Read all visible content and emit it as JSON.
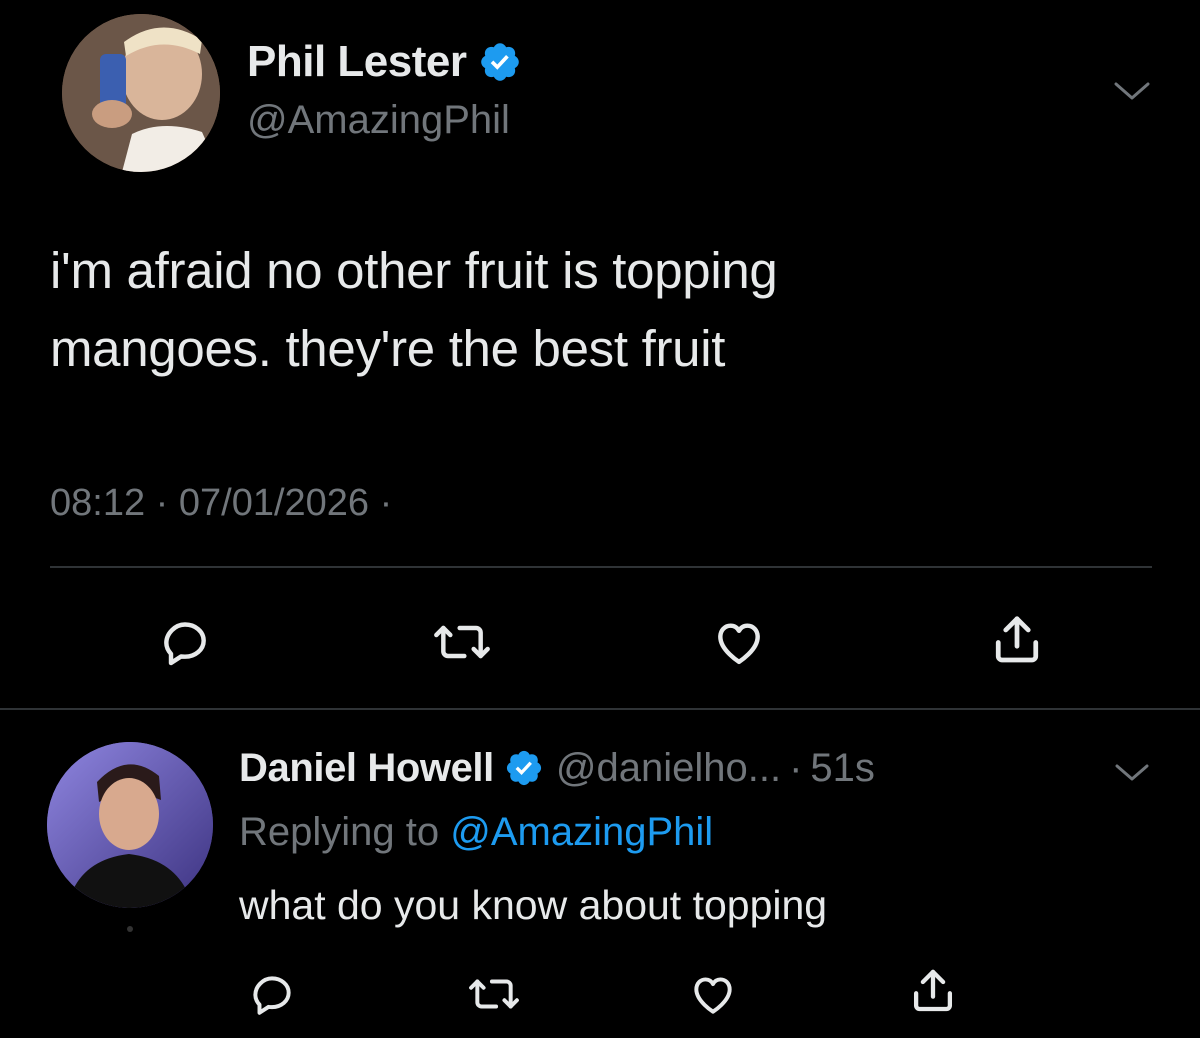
{
  "colors": {
    "background": "#000000",
    "primary_text": "#e7e9ea",
    "secondary_text": "#71767b",
    "accent": "#1d9bf0",
    "divider": "#2f3336"
  },
  "main_tweet": {
    "author_name": "Phil Lester",
    "author_handle": "@AmazingPhil",
    "verified": true,
    "text_lines": [
      "i'm afraid no other fruit is topping",
      "mangoes. they're the best fruit"
    ],
    "meta": "08:12 · 07/01/2026 ·",
    "actions": [
      {
        "icon": "reply-icon"
      },
      {
        "icon": "retweet-icon"
      },
      {
        "icon": "like-icon"
      },
      {
        "icon": "share-icon"
      }
    ]
  },
  "reply": {
    "author_name": "Daniel Howell",
    "author_handle": "@danielho...",
    "separator": "·",
    "time": "51s",
    "verified": true,
    "replying_label": "Replying to",
    "replying_handle": "@AmazingPhil",
    "text": "what do you know about topping",
    "actions": [
      {
        "icon": "reply-icon"
      },
      {
        "icon": "retweet-icon"
      },
      {
        "icon": "like-icon"
      },
      {
        "icon": "share-icon"
      }
    ]
  }
}
